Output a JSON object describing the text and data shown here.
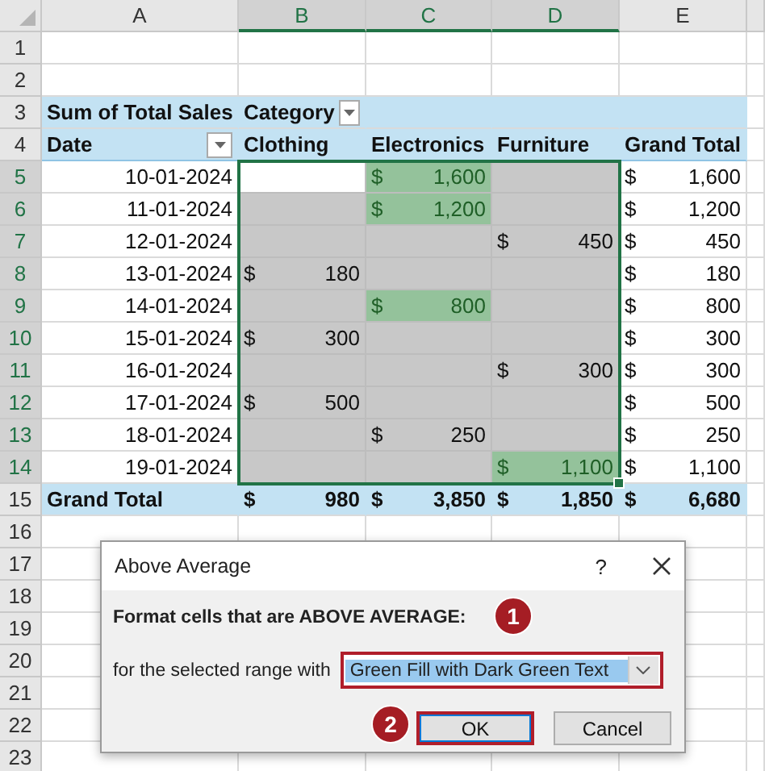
{
  "columns": [
    {
      "label": "A",
      "selected": false
    },
    {
      "label": "B",
      "selected": true
    },
    {
      "label": "C",
      "selected": true
    },
    {
      "label": "D",
      "selected": true
    },
    {
      "label": "E",
      "selected": false
    }
  ],
  "rows": [
    {
      "number": "1",
      "selected": false,
      "kind": "blank"
    },
    {
      "number": "2",
      "selected": false,
      "kind": "blank"
    },
    {
      "number": "3",
      "selected": false,
      "kind": "label",
      "label": "Sum of Total Sales",
      "field": "Category"
    },
    {
      "number": "4",
      "selected": false,
      "kind": "header",
      "cells": [
        "Date",
        "Clothing",
        "Electronics",
        "Furniture",
        "Grand Total"
      ]
    },
    {
      "number": "5",
      "selected": true,
      "kind": "data",
      "date": "10-01-2024",
      "cells": [
        {
          "selected": true,
          "active": true,
          "highlighted": false
        },
        {
          "symbol": "$",
          "amount": "1,600",
          "selected": true,
          "active": false,
          "highlighted": true
        },
        {
          "selected": true,
          "active": false,
          "highlighted": false
        }
      ],
      "total": {
        "symbol": "$",
        "amount": "1,600"
      }
    },
    {
      "number": "6",
      "selected": true,
      "kind": "data",
      "date": "11-01-2024",
      "cells": [
        {
          "selected": true,
          "active": false,
          "highlighted": false
        },
        {
          "symbol": "$",
          "amount": "1,200",
          "selected": true,
          "active": false,
          "highlighted": true
        },
        {
          "selected": true,
          "active": false,
          "highlighted": false
        }
      ],
      "total": {
        "symbol": "$",
        "amount": "1,200"
      }
    },
    {
      "number": "7",
      "selected": true,
      "kind": "data",
      "date": "12-01-2024",
      "cells": [
        {
          "selected": true,
          "active": false,
          "highlighted": false
        },
        {
          "selected": true,
          "active": false,
          "highlighted": false
        },
        {
          "symbol": "$",
          "amount": "450",
          "selected": true,
          "active": false,
          "highlighted": false
        }
      ],
      "total": {
        "symbol": "$",
        "amount": "450"
      }
    },
    {
      "number": "8",
      "selected": true,
      "kind": "data",
      "date": "13-01-2024",
      "cells": [
        {
          "symbol": "$",
          "amount": "180",
          "selected": true,
          "active": false,
          "highlighted": false
        },
        {
          "selected": true,
          "active": false,
          "highlighted": false
        },
        {
          "selected": true,
          "active": false,
          "highlighted": false
        }
      ],
      "total": {
        "symbol": "$",
        "amount": "180"
      }
    },
    {
      "number": "9",
      "selected": true,
      "kind": "data",
      "date": "14-01-2024",
      "cells": [
        {
          "selected": true,
          "active": false,
          "highlighted": false
        },
        {
          "symbol": "$",
          "amount": "800",
          "selected": true,
          "active": false,
          "highlighted": true
        },
        {
          "selected": true,
          "active": false,
          "highlighted": false
        }
      ],
      "total": {
        "symbol": "$",
        "amount": "800"
      }
    },
    {
      "number": "10",
      "selected": true,
      "kind": "data",
      "date": "15-01-2024",
      "cells": [
        {
          "symbol": "$",
          "amount": "300",
          "selected": true,
          "active": false,
          "highlighted": false
        },
        {
          "selected": true,
          "active": false,
          "highlighted": false
        },
        {
          "selected": true,
          "active": false,
          "highlighted": false
        }
      ],
      "total": {
        "symbol": "$",
        "amount": "300"
      }
    },
    {
      "number": "11",
      "selected": true,
      "kind": "data",
      "date": "16-01-2024",
      "cells": [
        {
          "selected": true,
          "active": false,
          "highlighted": false
        },
        {
          "selected": true,
          "active": false,
          "highlighted": false
        },
        {
          "symbol": "$",
          "amount": "300",
          "selected": true,
          "active": false,
          "highlighted": false
        }
      ],
      "total": {
        "symbol": "$",
        "amount": "300"
      }
    },
    {
      "number": "12",
      "selected": true,
      "kind": "data",
      "date": "17-01-2024",
      "cells": [
        {
          "symbol": "$",
          "amount": "500",
          "selected": true,
          "active": false,
          "highlighted": false
        },
        {
          "selected": true,
          "active": false,
          "highlighted": false
        },
        {
          "selected": true,
          "active": false,
          "highlighted": false
        }
      ],
      "total": {
        "symbol": "$",
        "amount": "500"
      }
    },
    {
      "number": "13",
      "selected": true,
      "kind": "data",
      "date": "18-01-2024",
      "cells": [
        {
          "selected": true,
          "active": false,
          "highlighted": false
        },
        {
          "symbol": "$",
          "amount": "250",
          "selected": true,
          "active": false,
          "highlighted": false
        },
        {
          "selected": true,
          "active": false,
          "highlighted": false
        }
      ],
      "total": {
        "symbol": "$",
        "amount": "250"
      }
    },
    {
      "number": "14",
      "selected": true,
      "kind": "data",
      "date": "19-01-2024",
      "cells": [
        {
          "selected": true,
          "active": false,
          "highlighted": false
        },
        {
          "selected": true,
          "active": false,
          "highlighted": false
        },
        {
          "symbol": "$",
          "amount": "1,100",
          "selected": true,
          "active": false,
          "highlighted": true
        }
      ],
      "total": {
        "symbol": "$",
        "amount": "1,100"
      }
    },
    {
      "number": "15",
      "selected": false,
      "kind": "total",
      "label": "Grand Total",
      "cells": [
        {
          "symbol": "$",
          "amount": "980"
        },
        {
          "symbol": "$",
          "amount": "3,850"
        },
        {
          "symbol": "$",
          "amount": "1,850"
        },
        {
          "symbol": "$",
          "amount": "6,680"
        }
      ]
    },
    {
      "number": "16",
      "selected": false,
      "kind": "blank"
    },
    {
      "number": "17",
      "selected": false,
      "kind": "blank"
    },
    {
      "number": "18",
      "selected": false,
      "kind": "blank"
    },
    {
      "number": "19",
      "selected": false,
      "kind": "blank"
    },
    {
      "number": "20",
      "selected": false,
      "kind": "blank"
    },
    {
      "number": "21",
      "selected": false,
      "kind": "blank"
    },
    {
      "number": "22",
      "selected": false,
      "kind": "blank"
    },
    {
      "number": "23",
      "selected": false,
      "kind": "blank"
    }
  ],
  "dialog": {
    "title": "Above Average",
    "help": "?",
    "prompt": "Format cells that are ABOVE AVERAGE:",
    "range_label": "for the selected range with",
    "format": "Green Fill with Dark Green Text",
    "buttons": [
      {
        "label": "OK",
        "focused": true
      },
      {
        "label": "Cancel",
        "focused": false
      }
    ],
    "callouts": [
      {
        "text": "1"
      },
      {
        "text": "2"
      }
    ]
  }
}
